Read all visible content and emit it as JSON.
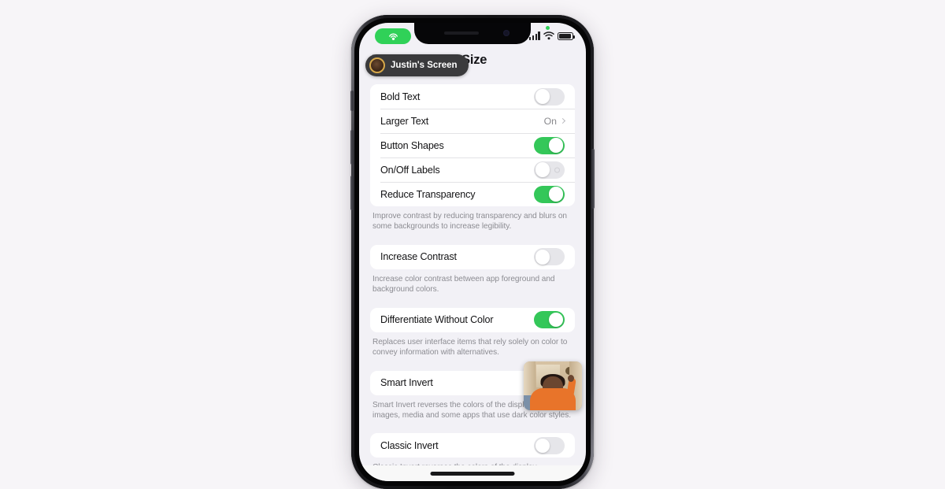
{
  "window": {
    "background_color": "#f7f5f8"
  },
  "phone": {
    "device_frame": "iphone",
    "side_buttons": [
      "silent-switch",
      "volume-up",
      "volume-down",
      "power"
    ]
  },
  "status_bar": {
    "sharing_indicator_icon": "screen-share-icon",
    "sharing_indicator_color": "#30d158",
    "privacy_dot_color": "#30d158",
    "signal_icon": "cellular-signal-icon",
    "signal_bars": 4,
    "wifi_icon": "wifi-icon",
    "battery_icon": "battery-icon",
    "battery_level_percent": 92
  },
  "screen_share_banner": {
    "avatar_icon": "user-avatar",
    "label": "Justin's Screen"
  },
  "nav": {
    "title": "Display & Text Size"
  },
  "sections": [
    {
      "rows": [
        {
          "label": "Bold Text",
          "control": "toggle",
          "value": "off"
        },
        {
          "label": "Larger Text",
          "control": "disclosure",
          "value": "On"
        },
        {
          "label": "Button Shapes",
          "control": "toggle",
          "value": "on"
        },
        {
          "label": "On/Off Labels",
          "control": "toggle",
          "value": "off"
        },
        {
          "label": "Reduce Transparency",
          "control": "toggle",
          "value": "on"
        }
      ],
      "footnote": "Improve contrast by reducing transparency and blurs on some backgrounds to increase legibility."
    },
    {
      "rows": [
        {
          "label": "Increase Contrast",
          "control": "toggle",
          "value": "off"
        }
      ],
      "footnote": "Increase color contrast between app foreground and background colors."
    },
    {
      "rows": [
        {
          "label": "Differentiate Without Color",
          "control": "toggle",
          "value": "on"
        }
      ],
      "footnote": "Replaces user interface items that rely solely on color to convey information with alternatives."
    },
    {
      "rows": [
        {
          "label": "Smart Invert",
          "control": "toggle",
          "value": "off"
        }
      ],
      "footnote": "Smart Invert reverses the colors of the display, except for images, media and some apps that use dark color styles."
    },
    {
      "rows": [
        {
          "label": "Classic Invert",
          "control": "toggle",
          "value": "off"
        }
      ],
      "footnote": "Classic Invert reverses the colors of the display."
    }
  ],
  "pip_video": {
    "description": "facetime-participant-video"
  },
  "colors": {
    "toggle_on": "#34c759",
    "toggle_off": "#e6e6ea",
    "card": "#ffffff",
    "list_background": "#f2f1f6",
    "label_text": "#121214",
    "secondary_text": "#8a8a8e"
  }
}
